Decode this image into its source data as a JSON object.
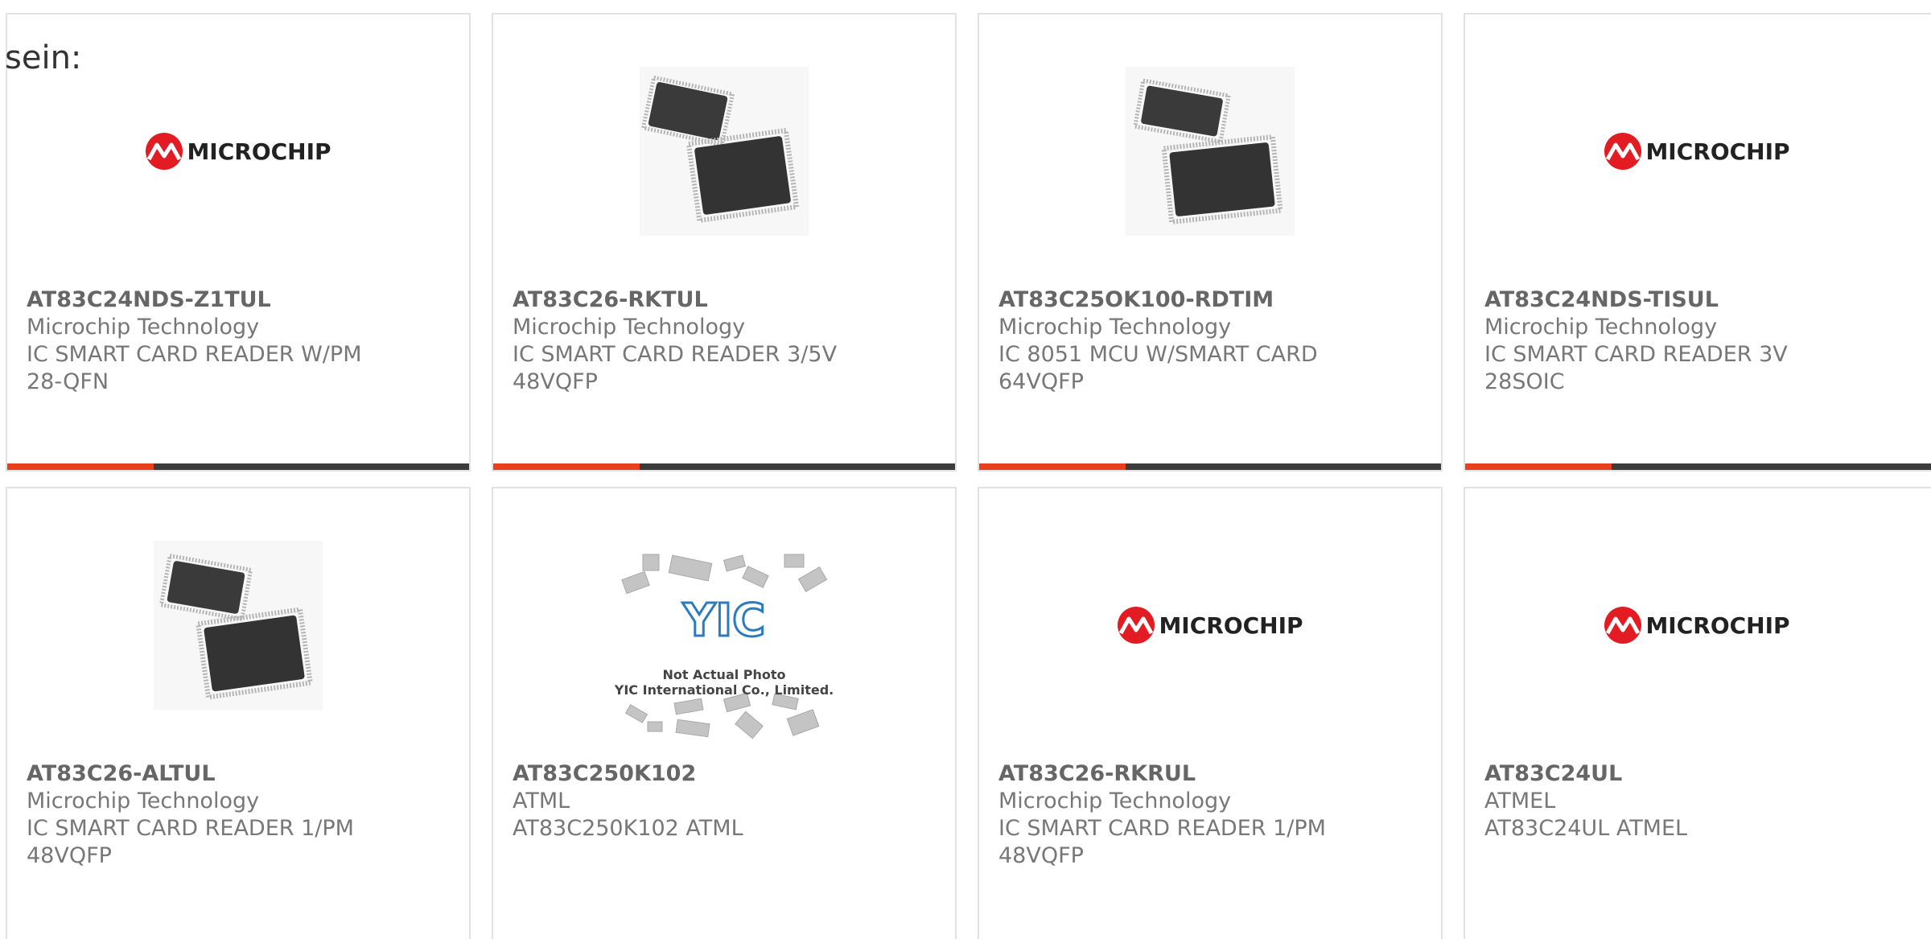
{
  "prefix_text": "sein:",
  "colors": {
    "accent": "#e8401c",
    "bar": "#3c3c3c",
    "logo_red": "#e31b23"
  },
  "logo_text": "MICROCHIP",
  "placeholder": {
    "line1": "Not Actual Photo",
    "line2": "YIC International Co., Limited."
  },
  "products": [
    {
      "part": "AT83C24NDS-Z1TUL",
      "maker": "Microchip Technology",
      "desc": "IC SMART CARD READER W/PM",
      "pkg": "28-QFN",
      "image": "microchip-logo"
    },
    {
      "part": "AT83C26-RKTUL",
      "maker": "Microchip Technology",
      "desc": "IC SMART CARD READER 3/5V",
      "pkg": "48VQFP",
      "image": "qfp-chips-photo"
    },
    {
      "part": "AT83C25OK100-RDTIM",
      "maker": "Microchip Technology",
      "desc": "IC 8051 MCU W/SMART CARD",
      "pkg": "64VQFP",
      "image": "qfp-chips-photo"
    },
    {
      "part": "AT83C24NDS-TISUL",
      "maker": "Microchip Technology",
      "desc": "IC SMART CARD READER 3V",
      "pkg": "28SOIC",
      "image": "microchip-logo"
    },
    {
      "part": "AT83C26-ALTUL",
      "maker": "Microchip Technology",
      "desc": "IC SMART CARD READER 1/PM",
      "pkg": "48VQFP",
      "image": "qfp-chips-photo"
    },
    {
      "part": "AT83C250K102",
      "maker": "ATML",
      "desc": "AT83C250K102 ATML",
      "pkg": "",
      "image": "yic-placeholder"
    },
    {
      "part": "AT83C26-RKRUL",
      "maker": "Microchip Technology",
      "desc": "IC SMART CARD READER 1/PM",
      "pkg": "48VQFP",
      "image": "microchip-logo"
    },
    {
      "part": "AT83C24UL",
      "maker": "ATMEL",
      "desc": "AT83C24UL ATMEL",
      "pkg": "",
      "image": "microchip-logo"
    }
  ]
}
